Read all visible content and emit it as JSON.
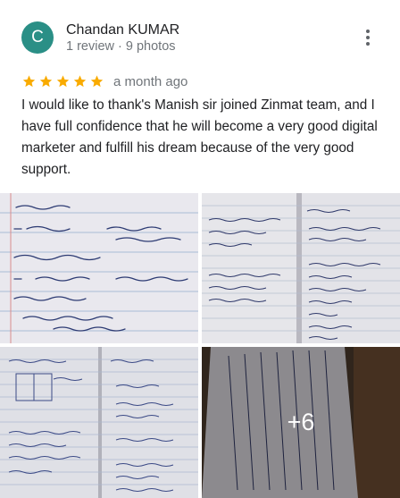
{
  "reviewer": {
    "initial": "C",
    "name": "Chandan KUMAR",
    "meta": "1 review · 9 photos",
    "avatar_color": "#2a8f86"
  },
  "more_options_icon": "vertical-dots-icon",
  "rating": {
    "stars": 5,
    "color": "#f9ab00",
    "time": "a month ago"
  },
  "review_text": "I would like to thank's Manish sir joined Zinmat team, and I have full confidence that he will become a very good digital marketer and fulfill his dream because of the very good support.",
  "photos": {
    "tiles": [
      {
        "name": "photo-notebook-1",
        "alt": "notebook page 1"
      },
      {
        "name": "photo-notebook-2",
        "alt": "notebook page 2"
      },
      {
        "name": "photo-notebook-3",
        "alt": "notebook page 3"
      },
      {
        "name": "photo-notebook-4",
        "alt": "notebook page 4"
      }
    ],
    "more_count_label": "+6"
  }
}
